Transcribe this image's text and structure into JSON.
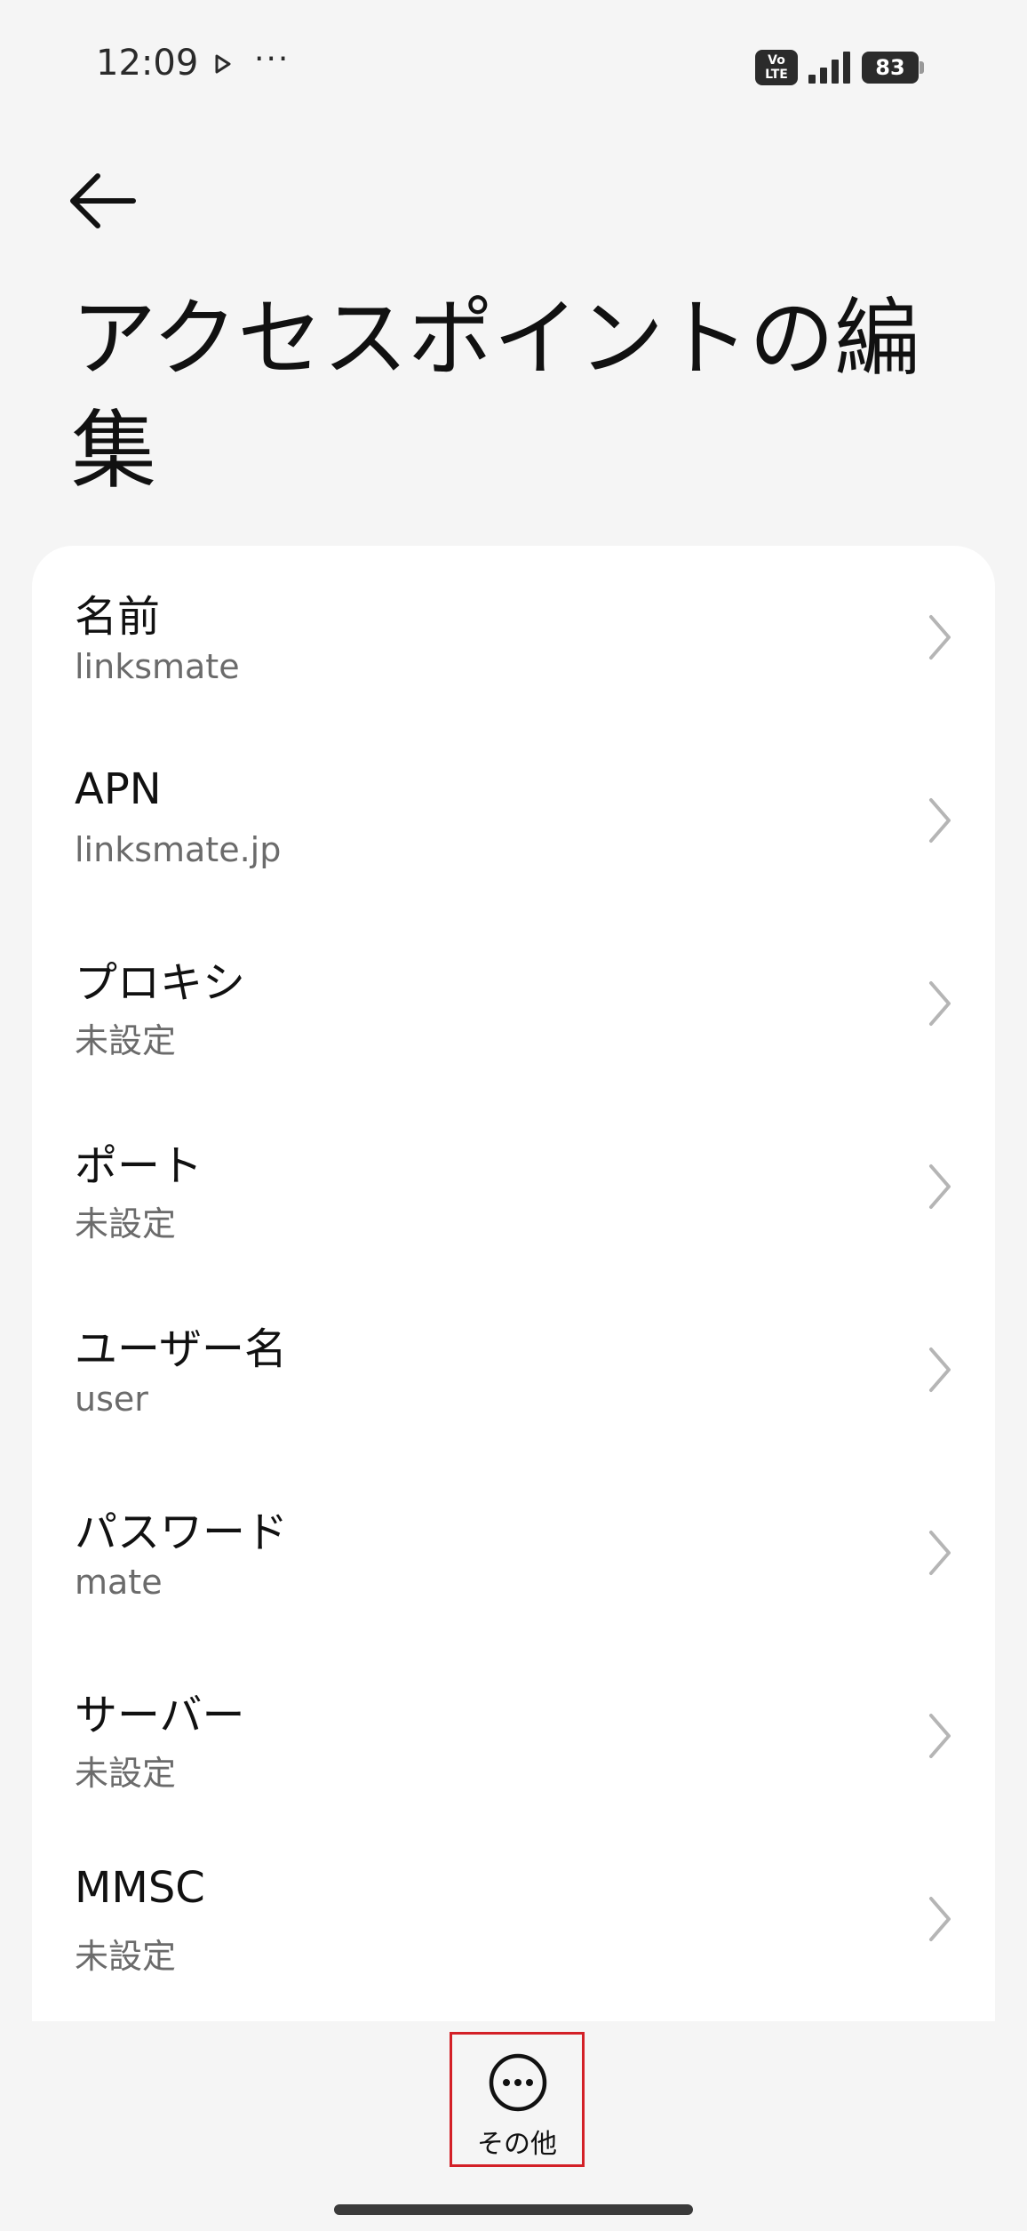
{
  "status_bar": {
    "time": "12:09",
    "dots": "···",
    "volte": "Vo LTE",
    "battery": "83"
  },
  "header": {
    "title": "アクセスポイントの編集"
  },
  "settings": {
    "items": [
      {
        "label": "名前",
        "value": "linksmate"
      },
      {
        "label": "APN",
        "value": "linksmate.jp"
      },
      {
        "label": "プロキシ",
        "value": "未設定"
      },
      {
        "label": "ポート",
        "value": "未設定"
      },
      {
        "label": "ユーザー名",
        "value": "user"
      },
      {
        "label": "パスワード",
        "value": "mate"
      },
      {
        "label": "サーバー",
        "value": "未設定"
      },
      {
        "label": "MMSC",
        "value": "未設定"
      }
    ]
  },
  "bottom_bar": {
    "more_label": "その他"
  },
  "icons": {
    "back": "arrow-left-icon",
    "chevron": "chevron-right-icon",
    "more": "more-horizontal-circle-icon",
    "play": "play-icon",
    "signal": "cellular-signal-icon",
    "battery": "battery-icon"
  }
}
